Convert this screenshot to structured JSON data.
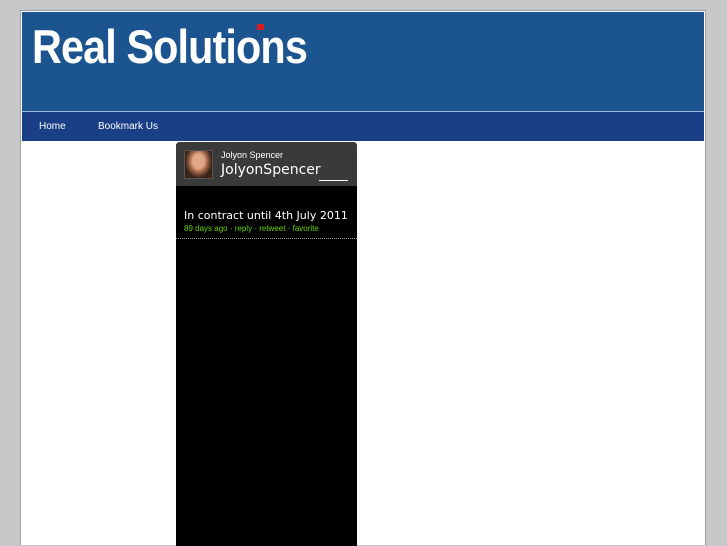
{
  "header": {
    "logo_text": "Real Solutions",
    "colors": {
      "header_bg": "#1c5490",
      "nav_bg": "#1b3f86",
      "accent": "#d81e1e"
    }
  },
  "nav": {
    "items": [
      {
        "label": "Home"
      },
      {
        "label": "Bookmark Us"
      }
    ]
  },
  "twitter_widget": {
    "author_name": "Jolyon Spencer",
    "handle": "JolyonSpencer",
    "avatar_icon": "profile-photo",
    "tweets": [
      {
        "text": "In contract until 4th July 2011",
        "time": "89 days ago",
        "reply": "reply",
        "retweet": "retweet",
        "favorite": "favorite",
        "separator": "·"
      }
    ],
    "colors": {
      "meta": "#66d400",
      "bg": "#000000",
      "head_bg": "#3a3a3a"
    }
  }
}
